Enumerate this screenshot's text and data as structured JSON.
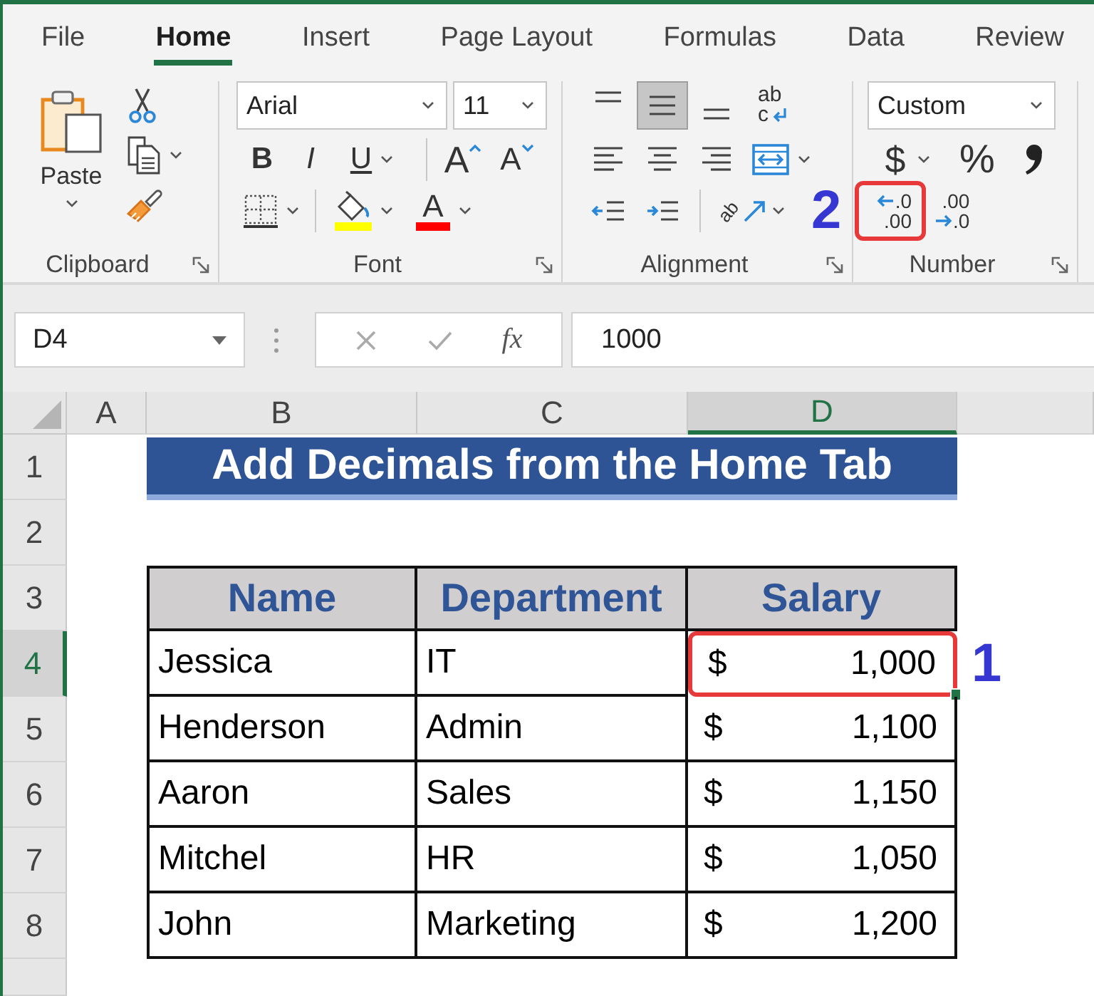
{
  "tabs": [
    {
      "label": "File",
      "selected": false
    },
    {
      "label": "Home",
      "selected": true
    },
    {
      "label": "Insert",
      "selected": false
    },
    {
      "label": "Page Layout",
      "selected": false
    },
    {
      "label": "Formulas",
      "selected": false
    },
    {
      "label": "Data",
      "selected": false
    },
    {
      "label": "Review",
      "selected": false
    }
  ],
  "ribbon": {
    "clipboard": {
      "label": "Clipboard",
      "paste": "Paste"
    },
    "font": {
      "label": "Font",
      "font_name": "Arial",
      "font_size": "11",
      "bold": "B",
      "italic": "I",
      "underline": "U",
      "grow": "A",
      "shrink": "A",
      "font_color": "A"
    },
    "alignment": {
      "label": "Alignment",
      "vertical": [
        {
          "kind": "top",
          "selected": false
        },
        {
          "kind": "middle",
          "selected": true
        },
        {
          "kind": "bottom",
          "selected": false
        }
      ],
      "wrap_text": {
        "top": "ab",
        "bottom": "c"
      },
      "orientation": "ab"
    },
    "number": {
      "label": "Number",
      "format": "Custom",
      "currency": "$",
      "percent": "%",
      "callout": "2",
      "decimal_buttons": [
        {
          "kind": "increase",
          "top": ".0",
          "bottom": ".00",
          "highlighted": true
        },
        {
          "kind": "decrease",
          "top": ".00",
          "bottom": ".0",
          "highlighted": false
        }
      ]
    }
  },
  "formula_bar": {
    "name_box": "D4",
    "function": "fx",
    "formula": "1000"
  },
  "sheet": {
    "columns": [
      {
        "label": "A",
        "selected": false
      },
      {
        "label": "B",
        "selected": false
      },
      {
        "label": "C",
        "selected": false
      },
      {
        "label": "D",
        "selected": true
      }
    ],
    "rows": [
      {
        "label": "1",
        "selected": false
      },
      {
        "label": "2",
        "selected": false
      },
      {
        "label": "3",
        "selected": false
      },
      {
        "label": "4",
        "selected": true
      },
      {
        "label": "5",
        "selected": false
      },
      {
        "label": "6",
        "selected": false
      },
      {
        "label": "7",
        "selected": false
      },
      {
        "label": "8",
        "selected": false
      }
    ],
    "title": "Add Decimals from the Home Tab",
    "table": {
      "columns": [
        "Name",
        "Department",
        "Salary"
      ],
      "rows": [
        {
          "name": "Jessica",
          "department": "IT",
          "currency": "$",
          "salary": "1,000",
          "highlighted": true
        },
        {
          "name": "Henderson",
          "department": "Admin",
          "currency": "$",
          "salary": "1,100",
          "highlighted": false
        },
        {
          "name": "Aaron",
          "department": "Sales",
          "currency": "$",
          "salary": "1,150",
          "highlighted": false
        },
        {
          "name": "Mitchel",
          "department": "HR",
          "currency": "$",
          "salary": "1,050",
          "highlighted": false
        },
        {
          "name": "John",
          "department": "Marketing",
          "currency": "$",
          "salary": "1,200",
          "highlighted": false
        }
      ]
    },
    "callout": "1"
  }
}
